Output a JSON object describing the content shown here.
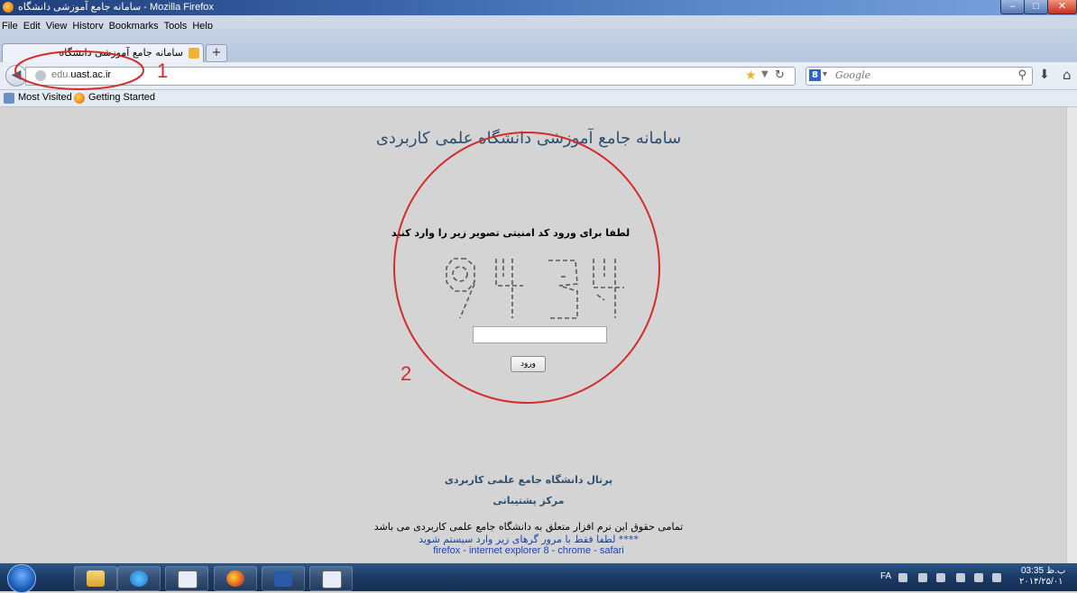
{
  "window": {
    "title": "سامانه جامع آموزشی دانشگاه - Mozilla Firefox",
    "controls": {
      "minimize": "–",
      "maximize": "□",
      "close": "✕"
    }
  },
  "menubar": {
    "items": [
      {
        "label": "File"
      },
      {
        "label": "Edit"
      },
      {
        "label": "View"
      },
      {
        "label": "History"
      },
      {
        "label": "Bookmarks"
      },
      {
        "label": "Tools"
      },
      {
        "label": "Help"
      }
    ]
  },
  "tabs": [
    {
      "label": "سامانه جامع آموزشی دانشگاه",
      "active": true
    }
  ],
  "new_tab_label": "+",
  "navbar": {
    "back_glyph": "◀",
    "url_prefix": "edu.",
    "url_domain": "uast.ac.ir",
    "search": {
      "engine_icon": "8",
      "placeholder": "Google"
    },
    "icons": [
      "back-icon",
      "globe-icon",
      "star-icon",
      "reload-icon",
      "search-icon",
      "download-icon",
      "home-icon"
    ]
  },
  "bookmarks": [
    {
      "label": "Most Visited"
    },
    {
      "label": "Getting Started"
    }
  ],
  "page": {
    "title": "سامانه جامع آموزشی دانشگاه علمی کاربردی",
    "captcha_prompt": "لطفا برای ورود کد امنیتی تصویر زیر را وارد کنید",
    "captcha_value": "9434",
    "captcha_input_value": "",
    "submit_label": "ورود",
    "footer": {
      "portal": "پرتال دانشگاه جامع علمی کاربردی",
      "support": "مرکز پشتیبانی",
      "copyright": "تمامی حقوق این نرم افزار متعلق به دانشگاه جامع علمی کاربردی می باشد",
      "browser_note": "**** لطفا فقط با مرور گرهای زیر وارد سیستم شوید",
      "browser_list": "firefox - internet explorer 8 - chrome - safari"
    }
  },
  "annotations": [
    {
      "label": "1"
    },
    {
      "label": "2"
    }
  ],
  "taskbar": {
    "pinned": [
      "windows-explorer",
      "internet-explorer",
      "calculator",
      "firefox",
      "word",
      "calculator"
    ],
    "language": "FA",
    "time": "03:35 ب.ظ",
    "date": "۲۰۱۴/۲۵/۰۱"
  }
}
